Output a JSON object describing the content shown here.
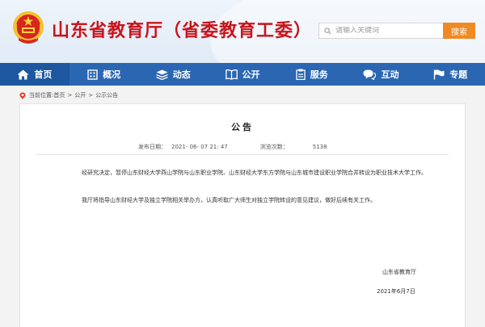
{
  "header": {
    "title": "山东省教育厅（省委教育工委）",
    "search_placeholder": "请输入关键词",
    "search_button": "搜索",
    "colors": {
      "title": "#c8141b",
      "search_button": "#f08a22",
      "nav": "#2a66b2"
    }
  },
  "nav": {
    "items": [
      {
        "label": "首页",
        "icon": "home-icon"
      },
      {
        "label": "概况",
        "icon": "building-icon"
      },
      {
        "label": "动态",
        "icon": "stack-icon"
      },
      {
        "label": "公开",
        "icon": "book-icon"
      },
      {
        "label": "服务",
        "icon": "clipboard-icon"
      },
      {
        "label": "互动",
        "icon": "chat-icon"
      },
      {
        "label": "专题",
        "icon": "flag-icon"
      }
    ]
  },
  "breadcrumb": {
    "prefix": "当前位置:",
    "items": [
      "首页",
      "公开",
      "公示公告"
    ],
    "separator": ">"
  },
  "article": {
    "title": "公告",
    "publish_label": "发布日期：",
    "publish_date": "2021- 06- 07 21: 47",
    "views_label": "浏览次数：",
    "views": "5138",
    "paragraphs": [
      "经研究决定，暂停山东财经大学燕山学院与山东职业学院、山东财经大学东方学院与山东城市建设职业学院合并转设为职业技术大学工作。",
      "我厅将指导山东财经大学及独立学院相关举办方，认真听取广大师生对独立学院转设的意见建议，做好后续有关工作。"
    ],
    "signature_org": "山东省教育厅",
    "signature_date": "2021年6月7日"
  }
}
